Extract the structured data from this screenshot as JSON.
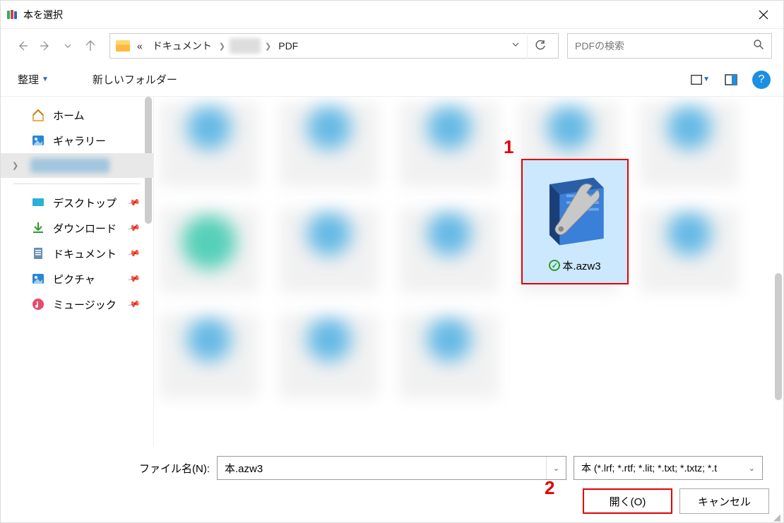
{
  "title": "本を選択",
  "breadcrumb": {
    "seg1": "ドキュメント",
    "seg2": "PDF",
    "chevrons": "«"
  },
  "search": {
    "placeholder": "PDFの検索"
  },
  "toolbar": {
    "organize": "整理",
    "newfolder": "新しいフォルダー",
    "help_tip": "?"
  },
  "sidebar": {
    "home": "ホーム",
    "gallery": "ギャラリー",
    "desktop": "デスクトップ",
    "downloads": "ダウンロード",
    "documents": "ドキュメント",
    "pictures": "ピクチャ",
    "music": "ミュージック"
  },
  "selected_file": {
    "name": "本.azw3"
  },
  "markers": {
    "m1": "1",
    "m2": "2"
  },
  "footer": {
    "filename_label": "ファイル名(N):",
    "filename_value": "本.azw3",
    "filter": "本 (*.lrf; *.rtf; *.lit; *.txt; *.txtz; *.t",
    "open": "開く(O)",
    "cancel": "キャンセル"
  }
}
